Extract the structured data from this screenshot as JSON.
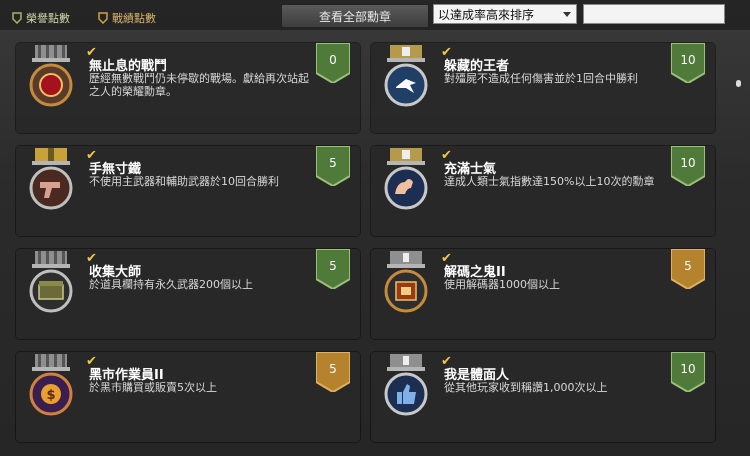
{
  "filters": {
    "honor_label": "榮譽點數",
    "combat_label": "戰績點數"
  },
  "view_all_label": "查看全部勳章",
  "sort": {
    "selected": "以達成率高來排序"
  },
  "search": {
    "value": ""
  },
  "colors": {
    "green_badge": "#4f7a3a",
    "gold_badge": "#b5822d",
    "check": "#f2c744"
  },
  "achievements": [
    {
      "title": "無止息的戰鬥",
      "desc": "歷經無數戰鬥仍未停歇的戰場。獻給再次站起之人的榮耀勳章。",
      "points": "0",
      "badge": "green",
      "icon": "red-orb-icon"
    },
    {
      "title": "躲藏的王者",
      "desc": "對殭屍不造成任何傷害並於1回合中勝利",
      "points": "10",
      "badge": "green",
      "icon": "dove-icon"
    },
    {
      "title": "手無寸鐵",
      "desc": "不使用主武器和輔助武器於10回合勝利",
      "points": "5",
      "badge": "green",
      "icon": "pistol-icon"
    },
    {
      "title": "充滿士氣",
      "desc": "達成人類士氣指數達150%以上10次的勳章",
      "points": "10",
      "badge": "green",
      "icon": "muscle-icon"
    },
    {
      "title": "收集大師",
      "desc": "於道具欄持有永久武器200個以上",
      "points": "5",
      "badge": "green",
      "icon": "crate-icon"
    },
    {
      "title": "解碼之鬼II",
      "desc": "使用解碼器1000個以上",
      "points": "5",
      "badge": "gold",
      "icon": "chip-icon"
    },
    {
      "title": "黑市作業員II",
      "desc": "於黑市購買或販賣5次以上",
      "points": "5",
      "badge": "gold",
      "icon": "coin-icon"
    },
    {
      "title": "我是體面人",
      "desc": "從其他玩家收到稱讚1,000次以上",
      "points": "10",
      "badge": "green",
      "icon": "thumbs-up-icon"
    }
  ]
}
